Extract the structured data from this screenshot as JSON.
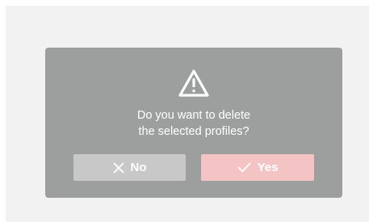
{
  "dialog": {
    "icon": "warning-icon",
    "message_line1": "Do you want to delete",
    "message_line2": "the selected profiles?",
    "no_button": {
      "label": "No",
      "icon": "close-icon"
    },
    "yes_button": {
      "label": "Yes",
      "icon": "check-icon"
    }
  },
  "colors": {
    "screen_bg": "#f2f2f2",
    "dialog_bg": "#9d9f9e",
    "no_button_bg": "#c7c8c7",
    "yes_button_bg": "#f4c4c4",
    "text": "#ffffff"
  }
}
